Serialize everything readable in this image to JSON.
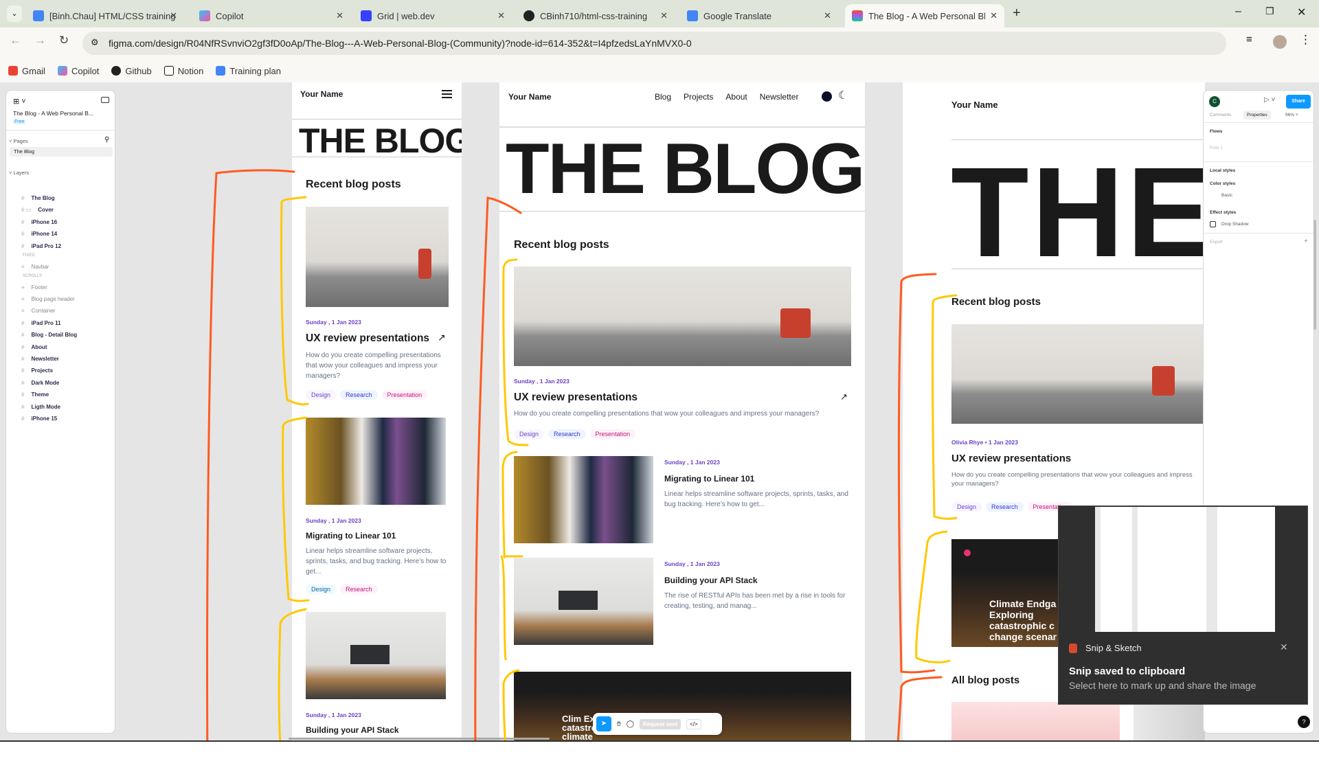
{
  "browser": {
    "tabs": [
      {
        "title": "[Binh.Chau] HTML/CSS training",
        "icon": "google-docs-icon",
        "color": "#4285f4"
      },
      {
        "title": "Copilot",
        "icon": "copilot-icon",
        "color": "#7b61ff"
      },
      {
        "title": "Grid | web.dev",
        "icon": "webdev-icon",
        "color": "#3740ff"
      },
      {
        "title": "CBinh710/html-css-training",
        "icon": "github-icon",
        "color": "#222222"
      },
      {
        "title": "Google Translate",
        "icon": "google-translate-icon",
        "color": "#4285f4"
      },
      {
        "title": "The Blog - A Web Personal Blog",
        "icon": "figma-icon",
        "color": "#f24e1e",
        "active": true
      }
    ],
    "new_tab": "+",
    "url": "figma.com/design/R04NfRSvnviO2gf3fD0oAp/The-Blog---A-Web-Personal-Blog-(Community)?node-id=614-352&t=I4pfzedsLaYnMVX0-0",
    "bookmarks": [
      {
        "label": "Gmail",
        "color": "#ea4335"
      },
      {
        "label": "Copilot",
        "color": "#7b61ff"
      },
      {
        "label": "Github",
        "color": "#222222"
      },
      {
        "label": "Notion",
        "color": "#111111"
      },
      {
        "label": "Training plan",
        "color": "#4285f4"
      }
    ]
  },
  "figma": {
    "file_name": "The Blog - A Web Personal B...",
    "plan": "Free",
    "pages_label": "Pages",
    "pages": [
      "The Blog"
    ],
    "layers_label": "Layers",
    "layers": [
      {
        "name": "The Blog",
        "indent": 0
      },
      {
        "name": "Cover",
        "indent": 1
      },
      {
        "name": "iPhone 16",
        "indent": 0
      },
      {
        "name": "iPhone 14",
        "indent": 0
      },
      {
        "name": "iPad Pro 12",
        "indent": 0
      },
      {
        "name": "FIXED",
        "indent": 2,
        "section": true
      },
      {
        "name": "Navbar",
        "indent": 2
      },
      {
        "name": "SCROLLS",
        "indent": 2,
        "section": true
      },
      {
        "name": "Footer",
        "indent": 2
      },
      {
        "name": "Blog page header",
        "indent": 2
      },
      {
        "name": "Container",
        "indent": 2
      },
      {
        "name": "iPad Pro 11",
        "indent": 0
      },
      {
        "name": "Blog - Detail Blog",
        "indent": 0
      },
      {
        "name": "About",
        "indent": 0
      },
      {
        "name": "Newsletter",
        "indent": 0
      },
      {
        "name": "Projects",
        "indent": 0
      },
      {
        "name": "Dark Mode",
        "indent": 0
      },
      {
        "name": "Theme",
        "indent": 0
      },
      {
        "name": "Ligth Mode",
        "indent": 0
      },
      {
        "name": "iPhone 15",
        "indent": 0
      }
    ],
    "right_panel": {
      "avatar": "C",
      "share": "Share",
      "tabs": [
        "Comments",
        "Properties"
      ],
      "zoom": "96%",
      "flows": "Flows",
      "flow1": "Flow 1",
      "local_styles": "Local styles",
      "color_styles": "Color styles",
      "basic": "Basic",
      "effect_styles": "Effect styles",
      "drop_shadow": "Drop Shadow",
      "export": "Export",
      "help": "?"
    },
    "toolbar": {
      "request": "Request sent"
    }
  },
  "blog": {
    "name": "Your Name",
    "hero": "THE BLOG",
    "hero_partial": "THE",
    "nav": [
      "Blog",
      "Projects",
      "About",
      "Newsletter"
    ],
    "recent": "Recent blog posts",
    "all": "All blog posts",
    "posts": [
      {
        "date": "Sunday , 1 Jan 2023",
        "author_date": "Olivia Rhye • 1 Jan 2023",
        "title": "UX review presentations",
        "desc": "How do you create compelling presentations that wow your colleagues and impress your managers?",
        "tags": [
          "Design",
          "Research",
          "Presentation"
        ]
      },
      {
        "date": "Sunday , 1 Jan 2023",
        "title": "Migrating to Linear 101",
        "desc": "Linear helps streamline software projects, sprints, tasks, and bug tracking. Here’s how to get...",
        "tags": [
          "Design",
          "Research"
        ]
      },
      {
        "date": "Sunday , 1 Jan 2023",
        "title": "Building your API Stack",
        "desc": "The rise of RESTful APIs has been met by a rise in tools for creating, testing, and manag..."
      }
    ],
    "featured_title": "Climate Endgame: Exploring catastrophic climate change scenarios",
    "featured_short": "Climate Endga Exploring catastrophic c change scenar",
    "featured_tablet": "Clim Expl catastrophic climate"
  },
  "toast": {
    "app": "Snip & Sketch",
    "title": "Snip saved to clipboard",
    "body": "Select here to mark up and share the image",
    "close": "✕"
  },
  "annotation_colors": {
    "orange": "#ff5a1f",
    "yellow": "#ffc800"
  }
}
